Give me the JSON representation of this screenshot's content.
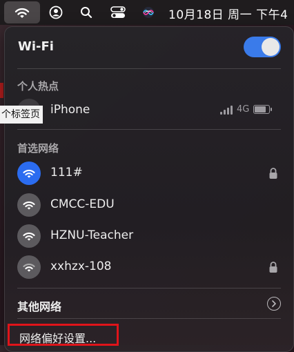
{
  "menubar": {
    "icons": [
      "wifi-icon",
      "user-icon",
      "search-icon",
      "control-center-icon",
      "siri-icon"
    ],
    "clock": "10月18日 周一 下午4"
  },
  "background": {
    "tab_label": "个标签页"
  },
  "panel": {
    "title": "Wi-Fi",
    "wifi_enabled": true,
    "accent_color": "#2b6cf0",
    "hotspot_section": "个人热点",
    "hotspot": {
      "name": "iPhone",
      "network_type": "4G",
      "signal_bars_filled": 4
    },
    "preferred_section": "首选网络",
    "networks": [
      {
        "name": "111#",
        "connected": true,
        "locked": true
      },
      {
        "name": "CMCC-EDU",
        "connected": false,
        "locked": false
      },
      {
        "name": "HZNU-Teacher",
        "connected": false,
        "locked": false
      },
      {
        "name": "xxhzx-108",
        "connected": false,
        "locked": true
      }
    ],
    "other_networks": "其他网络",
    "preferences": "网络偏好设置..."
  }
}
